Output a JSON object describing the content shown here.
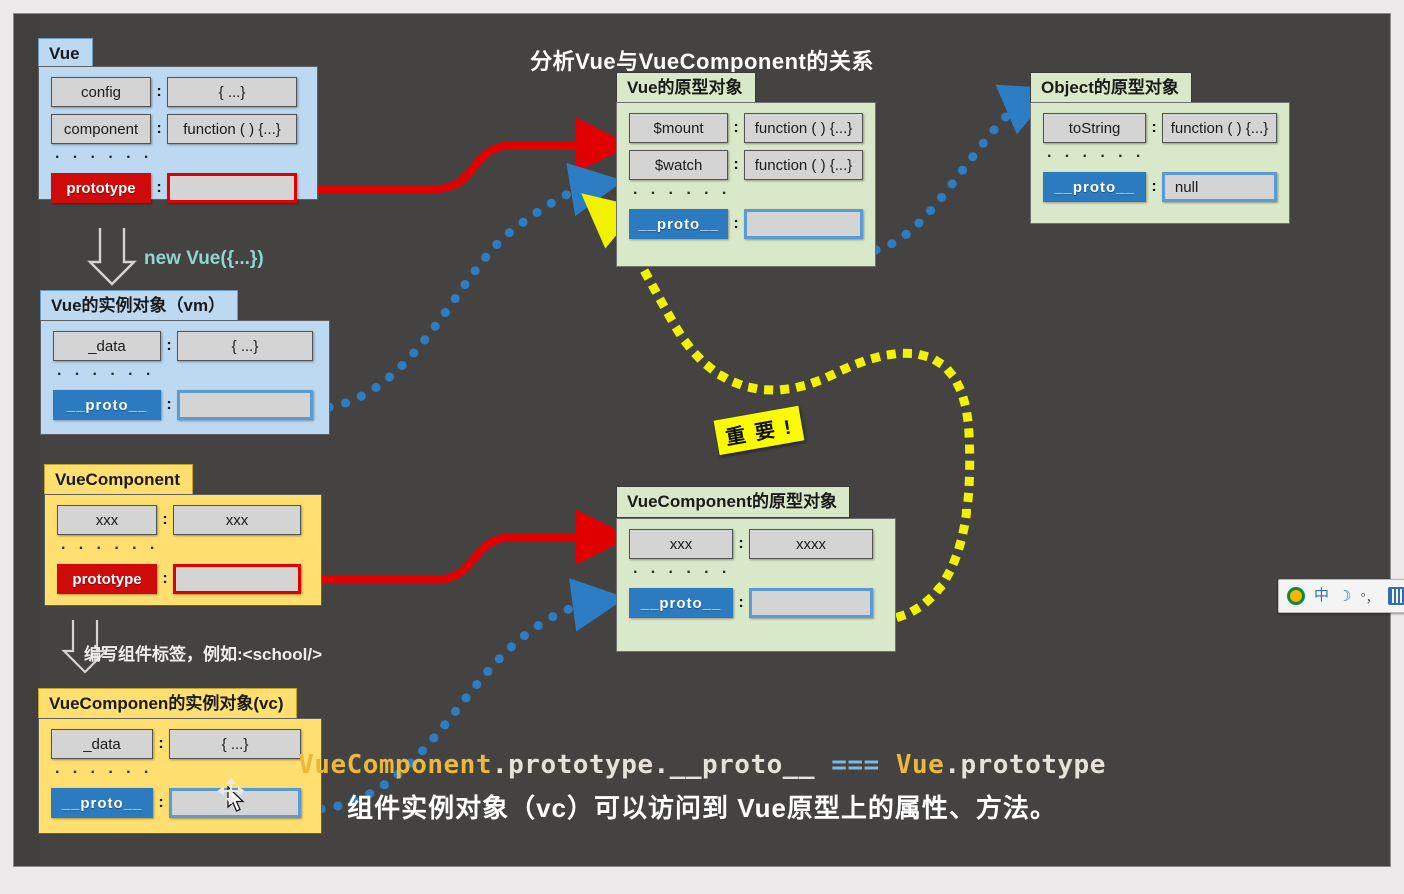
{
  "title": "分析Vue与VueComponent的关系",
  "boxes": {
    "vue": {
      "tab": "Vue",
      "rows": [
        {
          "key": "config",
          "value": "{ ...}"
        },
        {
          "key": "component",
          "value": "function ( ) {...}"
        }
      ],
      "ellipsis": "· · · · · ·",
      "proto_key": "prototype",
      "proto_value": ""
    },
    "vue_prototype": {
      "tab": "Vue的原型对象",
      "rows": [
        {
          "key": "$mount",
          "value": "function ( ) {...}"
        },
        {
          "key": "$watch",
          "value": "function ( ) {...}"
        }
      ],
      "ellipsis": "· · · · · ·",
      "proto_key": "__proto__",
      "proto_value": ""
    },
    "object_prototype": {
      "tab": "Object的原型对象",
      "rows": [
        {
          "key": "toString",
          "value": "function ( ) {...}"
        }
      ],
      "ellipsis": "· · · · · ·",
      "proto_key": "__proto__",
      "proto_value": "null"
    },
    "vm": {
      "tab": "Vue的实例对象（vm）",
      "rows": [
        {
          "key": "_data",
          "value": "{ ...}"
        }
      ],
      "ellipsis": "· · · · · ·",
      "proto_key": "__proto__",
      "proto_value": ""
    },
    "vuecomponent": {
      "tab": "VueComponent",
      "rows": [
        {
          "key": "xxx",
          "value": "xxx"
        }
      ],
      "ellipsis": "· · · · · ·",
      "proto_key": "prototype",
      "proto_value": ""
    },
    "vuecomponent_prototype": {
      "tab": "VueComponent的原型对象",
      "rows": [
        {
          "key": "xxx",
          "value": "xxxx"
        }
      ],
      "ellipsis": "· · · · · ·",
      "proto_key": "__proto__",
      "proto_value": ""
    },
    "vc": {
      "tab": "VueComponen的实例对象(vc)",
      "rows": [
        {
          "key": "_data",
          "value": "{ ...}"
        }
      ],
      "ellipsis": "· · · · · ·",
      "proto_key": "__proto__",
      "proto_value": ""
    }
  },
  "labels": {
    "new_vue": "new Vue({...})",
    "write_tag": "编写组件标签，例如:<school/>",
    "important": "重 要 !"
  },
  "conclusion": {
    "code_prefix": "VueComponent",
    "code_middle": ".prototype.__proto__ ",
    "code_eq": "===",
    "code_vue": " Vue",
    "code_suffix": ".prototype",
    "chinese": "组件实例对象（vc）可以访问到 Vue原型上的属性、方法。"
  },
  "ime": {
    "logo": "sogou-logo-icon",
    "mode": "中",
    "moon": "☽",
    "punctuation": "°，",
    "keyboard": "keyboard-icon"
  },
  "colors": {
    "canvas": "#444342",
    "blue_box": "#bcd9f1",
    "green_box": "#d9e8c8",
    "yellow_box": "#ffdf70",
    "proto_blue": "#2c7ac0",
    "proto_red": "#cf0a0a",
    "arrow_red": "#e00000",
    "arrow_blue": "#2d7dc4",
    "arrow_yellow": "#f2f200",
    "sticker_yellow": "#fbfb00",
    "accent_orange": "#e8b93b"
  }
}
